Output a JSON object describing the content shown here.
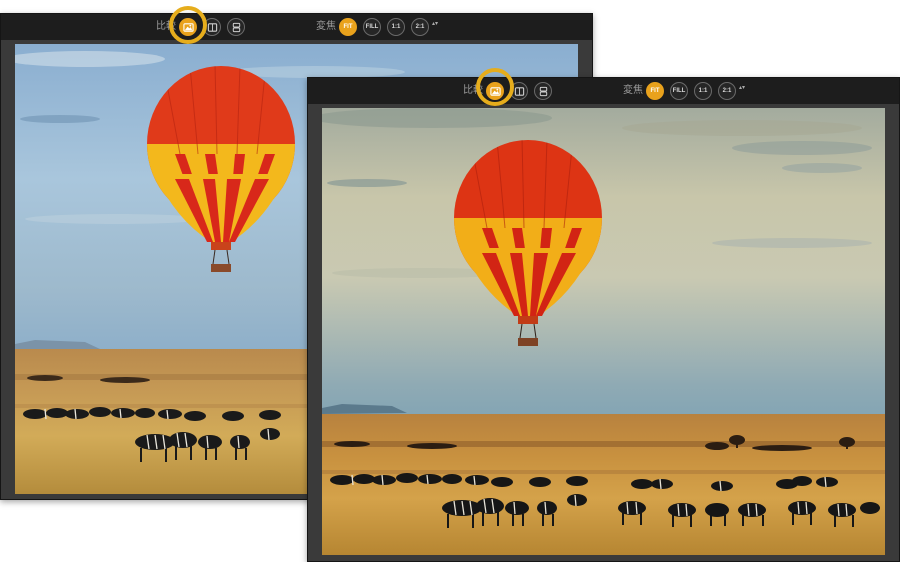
{
  "toolbar": {
    "compare_label": "比較",
    "zoom_label": "変焦",
    "zoom_fit": "FIT",
    "zoom_fill": "FILL",
    "zoom_1_1": "1:1",
    "zoom_2_1": "2:1",
    "updown_glyph": "▴▾"
  },
  "icons": {
    "compare_active": "image-compare-icon",
    "compare_split": "split-view-icon",
    "compare_stack": "stack-view-icon"
  },
  "colors": {
    "accent": "#e9a21c",
    "highlight_ring": "#e6ad1c",
    "toolbar_bg": "#1d1d1d",
    "panel_bg": "#3a3a3a"
  },
  "photo": {
    "subject": "hot-air-balloon-over-savanna-with-zebras"
  }
}
